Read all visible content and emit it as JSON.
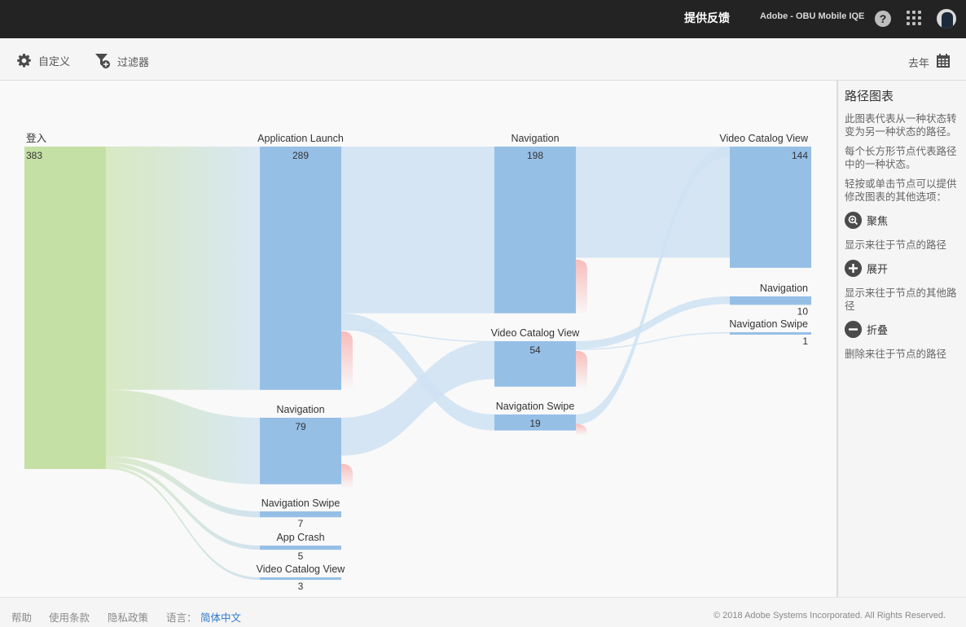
{
  "topbar": {
    "feedback": "提供反馈",
    "org": "Adobe - OBU Mobile IQE",
    "help_glyph": "?"
  },
  "toolbar": {
    "customize": "自定义",
    "filter": "过滤器",
    "range": "去年"
  },
  "panel": {
    "title": "路径图表",
    "desc1": "此图表代表从一种状态转变为另一种状态的路径。",
    "desc2": "每个长方形节点代表路径中的一种状态。",
    "desc3": "轻按或单击节点可以提供修改图表的其他选项：",
    "focus_label": "聚焦",
    "focus_desc": "显示来往于节点的路径",
    "expand_label": "展开",
    "expand_desc": "显示来往于节点的其他路径",
    "collapse_label": "折叠",
    "collapse_desc": "删除来往于节点的路径"
  },
  "footer": {
    "help": "帮助",
    "terms": "使用条款",
    "privacy": "隐私政策",
    "language_label": "语言：",
    "language": "简体中文",
    "copyright": "© 2018 Adobe Systems Incorporated. All Rights Reserved."
  },
  "colors": {
    "root_node": "#c5e0a5",
    "node": "#96bfe6",
    "link": "#cfe2f3",
    "exit": "#f9c6c6"
  },
  "chart_data": {
    "type": "sankey",
    "nodes": [
      {
        "id": "n0",
        "column": 0,
        "label": "登入",
        "value": 383
      },
      {
        "id": "n1",
        "column": 1,
        "label": "Application Launch",
        "value": 289
      },
      {
        "id": "n2",
        "column": 1,
        "label": "Navigation",
        "value": 79
      },
      {
        "id": "n3",
        "column": 1,
        "label": "Navigation Swipe",
        "value": 7
      },
      {
        "id": "n4",
        "column": 1,
        "label": "App Crash",
        "value": 5
      },
      {
        "id": "n5",
        "column": 1,
        "label": "Video Catalog View",
        "value": 3
      },
      {
        "id": "n6",
        "column": 2,
        "label": "Navigation",
        "value": 198
      },
      {
        "id": "n7",
        "column": 2,
        "label": "Video Catalog View",
        "value": 54
      },
      {
        "id": "n8",
        "column": 2,
        "label": "Navigation Swipe",
        "value": 19
      },
      {
        "id": "n9",
        "column": 3,
        "label": "Video Catalog View",
        "value": 144
      },
      {
        "id": "n10",
        "column": 3,
        "label": "Navigation",
        "value": 10
      },
      {
        "id": "n11",
        "column": 3,
        "label": "Navigation Swipe",
        "value": 1
      }
    ]
  }
}
